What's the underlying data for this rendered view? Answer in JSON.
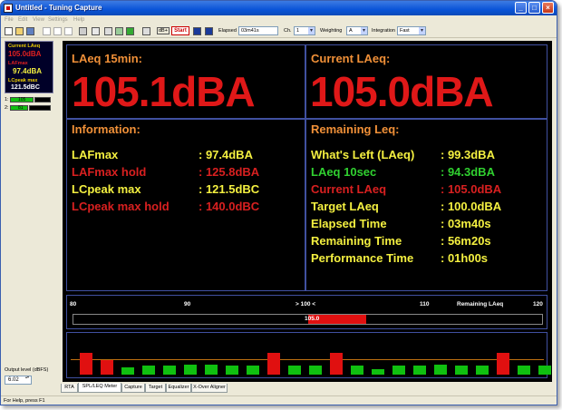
{
  "window": {
    "title": "Untitled - Tuning Capture"
  },
  "menu": [
    "File",
    "Edit",
    "View",
    "Settings",
    "Help"
  ],
  "toolbar": {
    "db_label": "dB+",
    "start_label": "Start",
    "elapsed_label": "Elapsed",
    "elapsed_value": "03m41s",
    "ch_label": "Ch.",
    "ch_value": "1",
    "weighting_label": "Weighting",
    "weighting_value": "A",
    "integration_label": "Integration",
    "integration_value": "Fast"
  },
  "left_panel": {
    "mini": [
      {
        "label": "Current LAeq",
        "value": "105.0dBA",
        "color": "#e02020"
      },
      {
        "label": "LAFmax",
        "value": "97.4dBA",
        "color": "#f4f040"
      },
      {
        "label": "LCpeak max",
        "value": "121.5dBC",
        "color": "#ffffff"
      }
    ],
    "meters": [
      {
        "ch": "1:",
        "value": "105"
      },
      {
        "ch": "2:",
        "value": "81"
      }
    ],
    "output_label": "Output level (dBFS)",
    "output_value": "6.02"
  },
  "laeq15": {
    "title": "LAeq 15min:",
    "value": "105.1dBA"
  },
  "current": {
    "title": "Current LAeq:",
    "value": "105.0dBA"
  },
  "information": {
    "title": "Information:",
    "rows": [
      {
        "key": "LAFmax",
        "value": ": 97.4dBA",
        "color": "y"
      },
      {
        "key": "LAFmax hold",
        "value": ": 125.8dBA",
        "color": "r"
      },
      {
        "key": "LCpeak max",
        "value": ": 121.5dBC",
        "color": "y"
      },
      {
        "key": "LCpeak max hold",
        "value": ": 140.0dBC",
        "color": "r"
      }
    ]
  },
  "remaining": {
    "title": "Remaining Leq:",
    "rows": [
      {
        "key": "What's Left (LAeq)",
        "value": ": 99.3dBA",
        "color": "y"
      },
      {
        "key": "LAeq 10sec",
        "value": ": 94.3dBA",
        "color": "g"
      },
      {
        "key": "Current LAeq",
        "value": ": 105.0dBA",
        "color": "r"
      },
      {
        "key": "Target LAeq",
        "value": ": 100.0dBA",
        "color": "y"
      },
      {
        "key": "Elapsed Time",
        "value": ": 03m40s",
        "color": "y"
      },
      {
        "key": "Remaining Time",
        "value": ": 56m20s",
        "color": "y"
      },
      {
        "key": "Performance Time",
        "value": ": 01h00s",
        "color": "y"
      }
    ]
  },
  "scale": {
    "labels": [
      "80",
      "90",
      "> 100 <",
      "110",
      "Remaining LAeq",
      "120"
    ],
    "level_value": "105.0",
    "level_fraction": 0.625,
    "red_start_fraction": 0.5
  },
  "history": {
    "bars": [
      {
        "level": 0.75,
        "color": "#e01010"
      },
      {
        "level": 0.5,
        "color": "#e01010"
      },
      {
        "level": 0.25,
        "color": "#10c010"
      },
      {
        "level": 0.3,
        "color": "#10c010"
      },
      {
        "level": 0.3,
        "color": "#10c010"
      },
      {
        "level": 0.35,
        "color": "#10c010"
      },
      {
        "level": 0.35,
        "color": "#10c010"
      },
      {
        "level": 0.3,
        "color": "#10c010"
      },
      {
        "level": 0.3,
        "color": "#10c010"
      },
      {
        "level": 0.75,
        "color": "#e01010"
      },
      {
        "level": 0.3,
        "color": "#10c010"
      },
      {
        "level": 0.3,
        "color": "#10c010"
      },
      {
        "level": 0.75,
        "color": "#e01010"
      },
      {
        "level": 0.3,
        "color": "#10c010"
      },
      {
        "level": 0.2,
        "color": "#10c010"
      },
      {
        "level": 0.3,
        "color": "#10c010"
      },
      {
        "level": 0.3,
        "color": "#10c010"
      },
      {
        "level": 0.35,
        "color": "#10c010"
      },
      {
        "level": 0.3,
        "color": "#10c010"
      },
      {
        "level": 0.3,
        "color": "#10c010"
      },
      {
        "level": 0.75,
        "color": "#e01010"
      },
      {
        "level": 0.3,
        "color": "#10c010"
      },
      {
        "level": 0.3,
        "color": "#10c010"
      }
    ],
    "target_level": 0.5
  },
  "tabs": [
    "RTA",
    "SPL/LEQ Meter",
    "Capture",
    "Target",
    "Equalizer",
    "X-Over Aligner"
  ],
  "status": "For Help, press F1"
}
